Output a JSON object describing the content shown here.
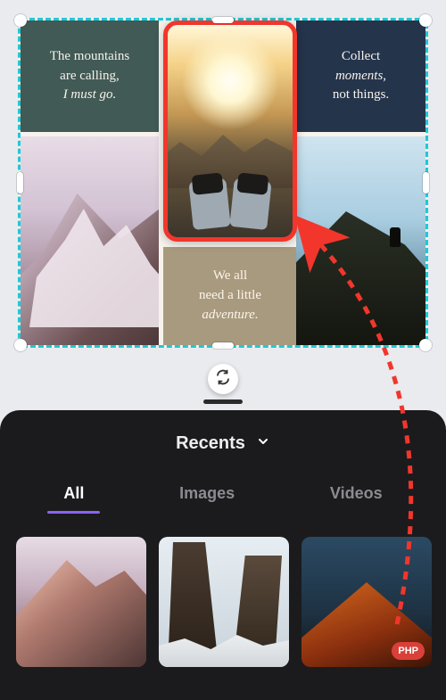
{
  "canvas": {
    "tiles": {
      "mountains_quote_line1": "The mountains",
      "mountains_quote_line2": "are calling,",
      "mountains_quote_line3": "I must go.",
      "collect_line1": "Collect",
      "collect_line2": "moments,",
      "collect_line3": "not things.",
      "adventure_line1": "We all",
      "adventure_line2": "need a little",
      "adventure_line3": "adventure."
    }
  },
  "swap": {
    "icon": "swap-icon"
  },
  "panel": {
    "dropdown_label": "Recents",
    "tabs": [
      {
        "label": "All",
        "active": true
      },
      {
        "label": "Images",
        "active": false
      },
      {
        "label": "Videos",
        "active": false
      }
    ],
    "thumbs": [
      {
        "name": "thumb-mountain-pink"
      },
      {
        "name": "thumb-rock-canyon"
      },
      {
        "name": "thumb-volcano",
        "badge": "PHP"
      }
    ]
  },
  "colors": {
    "selection_border": "#f2362c",
    "canvas_border": "#1ec8d8",
    "tab_indicator": "#8a63ff"
  }
}
